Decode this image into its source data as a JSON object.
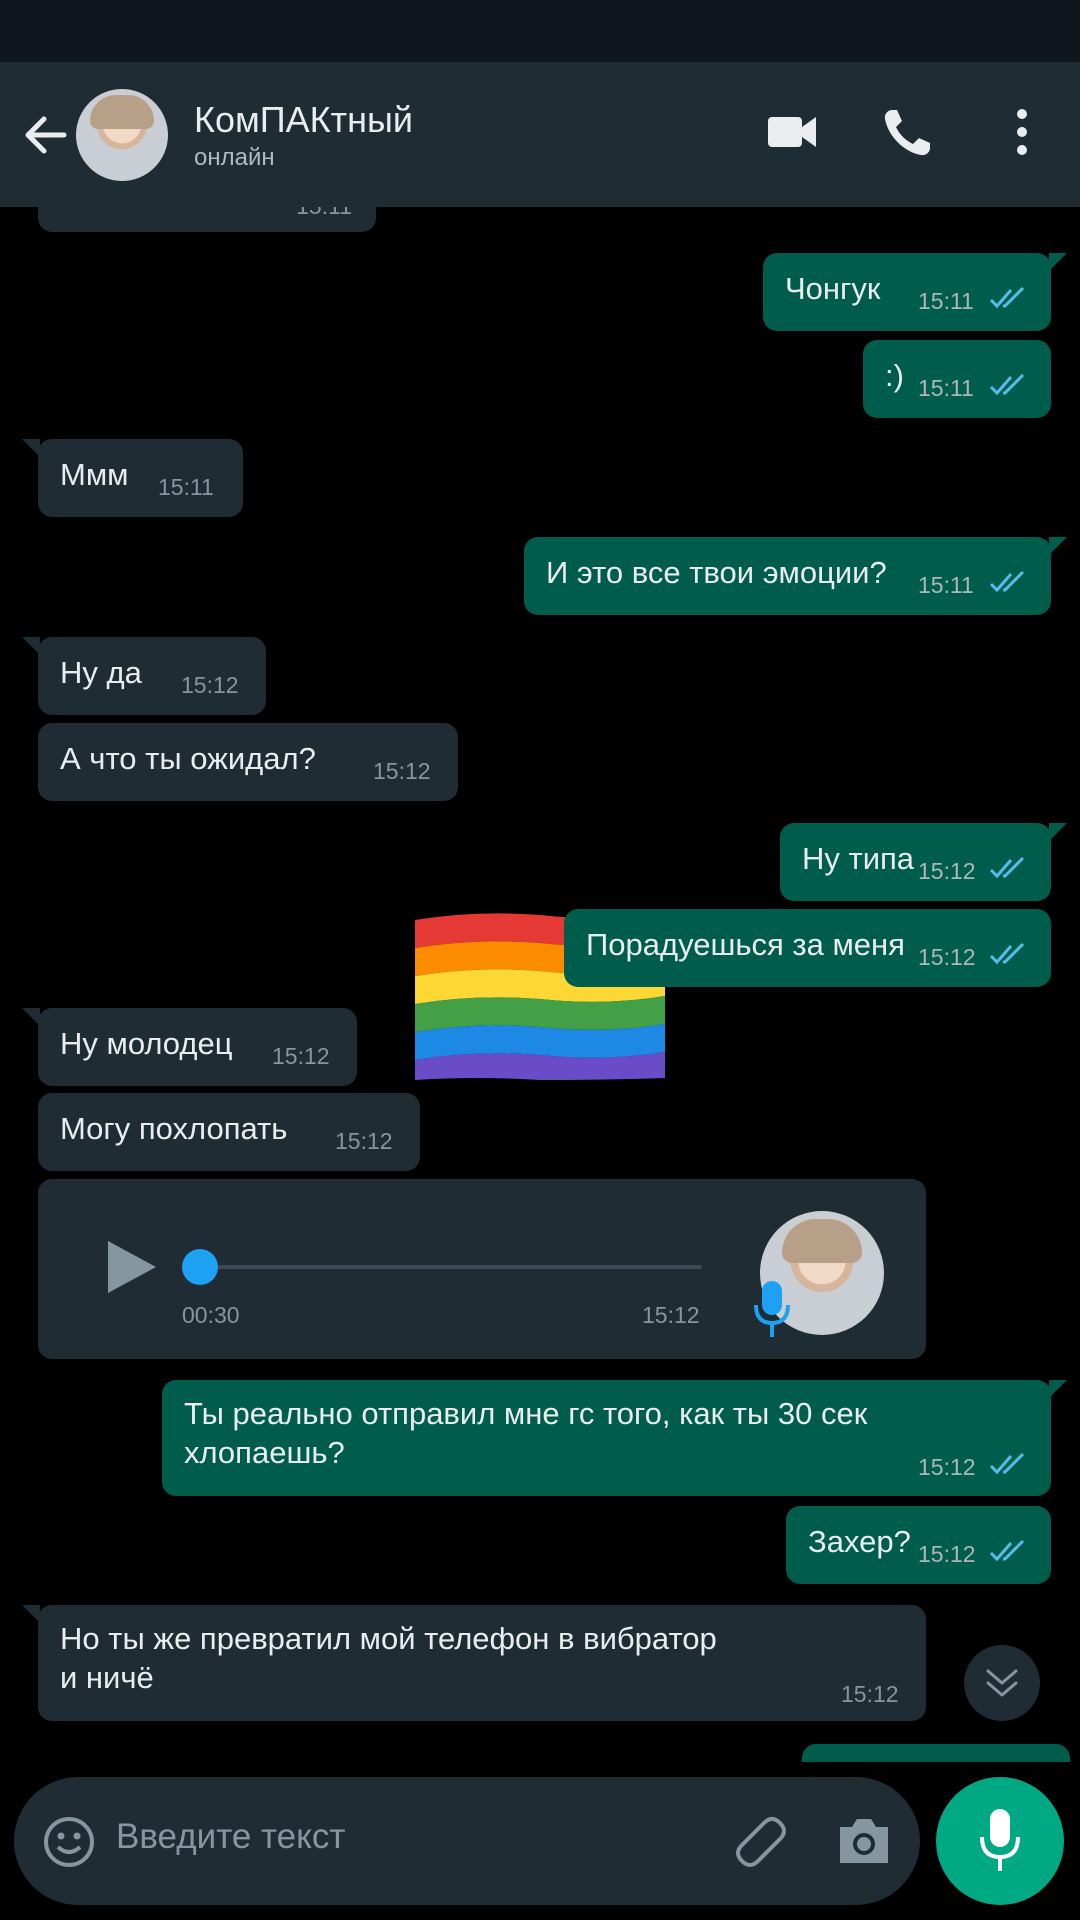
{
  "header": {
    "contact_name": "КомПАКтный",
    "contact_status": "онлайн",
    "icons": [
      "back-arrow-icon",
      "video-call-icon",
      "phone-call-icon",
      "more-vert-icon"
    ]
  },
  "messages": [
    {
      "dir": "in",
      "text": "",
      "time": "15:11"
    },
    {
      "dir": "out",
      "text": "Чонгук",
      "time": "15:11",
      "read": true
    },
    {
      "dir": "out",
      "text": ":)",
      "time": "15:11",
      "read": true
    },
    {
      "dir": "in",
      "text": "Ммм",
      "time": "15:11"
    },
    {
      "dir": "out",
      "text": "И это все твои эмоции?",
      "time": "15:11",
      "read": true
    },
    {
      "dir": "in",
      "text": "Ну да",
      "time": "15:12"
    },
    {
      "dir": "in",
      "text": "А что ты ожидал?",
      "time": "15:12"
    },
    {
      "dir": "out",
      "text": "Ну типа",
      "time": "15:12",
      "read": true
    },
    {
      "dir": "out",
      "text": "Порадуешься за меня",
      "time": "15:12",
      "read": true
    },
    {
      "dir": "in",
      "text": "Ну молодец",
      "time": "15:12"
    },
    {
      "dir": "in",
      "text": "Могу похлопать",
      "time": "15:12"
    },
    {
      "dir": "out",
      "text_line1": "Ты реально отправил мне гс того, как ты 30 сек",
      "text_line2": "хлопаешь?",
      "time": "15:12",
      "read": true
    },
    {
      "dir": "out",
      "text": "Захер?",
      "time": "15:12",
      "read": true
    },
    {
      "dir": "in",
      "text_line1": "Но ты же превратил мой телефон в вибратор",
      "text_line2": "и ничё",
      "time": "15:12"
    }
  ],
  "voice_message": {
    "duration": "00:30",
    "time": "15:12",
    "progress": 0
  },
  "sticker": {
    "icon": "rainbow-flag-icon"
  },
  "input": {
    "placeholder": "Введите текст",
    "icons": [
      "emoji-icon",
      "attach-icon",
      "camera-icon",
      "mic-icon"
    ]
  },
  "colors": {
    "header_bg": "#1f2c34",
    "incoming_bubble": "#1f2c34",
    "outgoing_bubble": "#005c4b",
    "read_ticks": "#53bdeb",
    "accent": "#00a884"
  }
}
